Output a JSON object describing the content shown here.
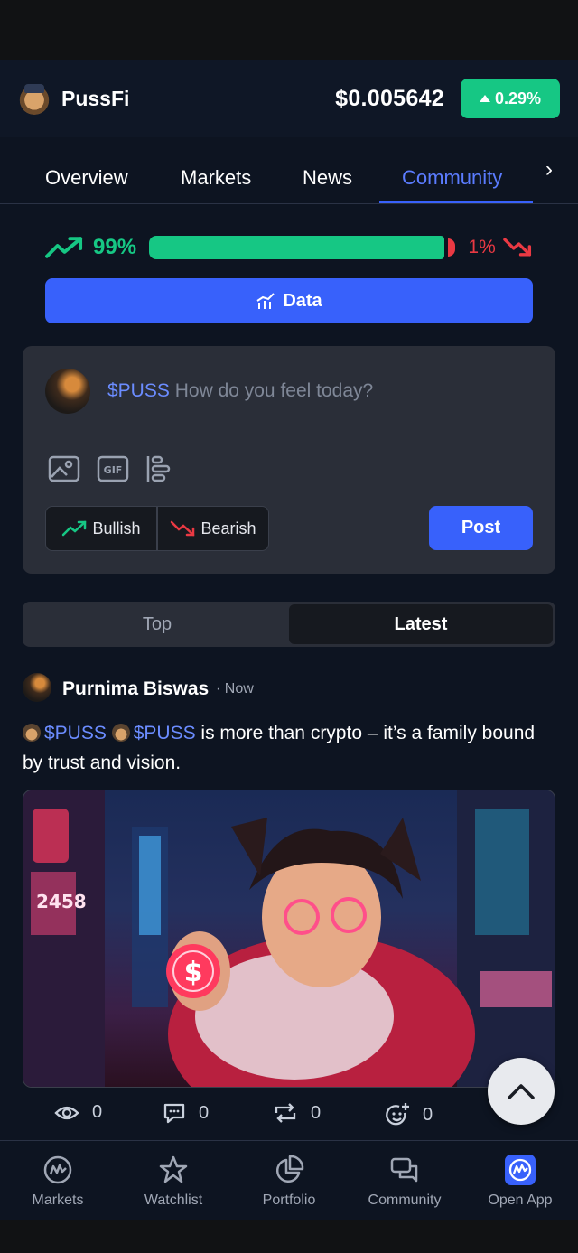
{
  "header": {
    "brand": "PussFi",
    "price": "$0.005642",
    "change": "0.29%",
    "change_color": "#16c784"
  },
  "tabs": {
    "items": [
      "Overview",
      "Markets",
      "News",
      "Community"
    ],
    "active": "Community"
  },
  "sentiment": {
    "bullish_pct": "99%",
    "bearish_pct": "1%",
    "bullish_fraction": 0.99
  },
  "data_button": {
    "label": "Data"
  },
  "compose": {
    "ticker": "$PUSS",
    "placeholder": "How do you feel today?",
    "bullish_label": "Bullish",
    "bearish_label": "Bearish",
    "post_label": "Post"
  },
  "feed_toggle": {
    "top": "Top",
    "latest": "Latest",
    "active": "Latest"
  },
  "post": {
    "author": "Purnima Biswas",
    "time": "· Now",
    "tag1": "$PUSS",
    "tag2": "$PUSS",
    "text": " is more than crypto – it’s a family bound by trust and vision.",
    "image_texts": [
      "2458"
    ],
    "stats": {
      "views": "0",
      "comments": "0",
      "reposts": "0",
      "reactions": "0"
    }
  },
  "bottom_nav": {
    "items": [
      "Markets",
      "Watchlist",
      "Portfolio",
      "Community",
      "Open App"
    ]
  },
  "colors": {
    "accent": "#3861fb",
    "bull": "#16c784",
    "bear": "#ea3943",
    "bg": "#0d1421"
  }
}
